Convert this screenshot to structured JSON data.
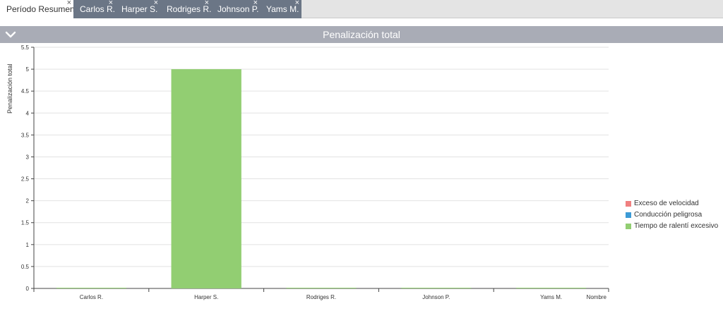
{
  "tabs": [
    {
      "label": "Período Resumen",
      "active": true
    },
    {
      "label": "Carlos R.",
      "active": false
    },
    {
      "label": "Harper S.",
      "active": false
    },
    {
      "label": "Rodriges R.",
      "active": false
    },
    {
      "label": "Johnson P.",
      "active": false
    },
    {
      "label": "Yams M.",
      "active": false
    }
  ],
  "tab_close_glyph": "×",
  "panel": {
    "title": "Penalización total",
    "collapse_icon": "chevron-down-icon"
  },
  "colors": {
    "speeding": "#f08080",
    "dangerous": "#3c9bd6",
    "idle": "#92ce72",
    "header": "#a9acb6",
    "tab": "#6b7686"
  },
  "chart_data": {
    "type": "bar",
    "ylabel": "Penalización total",
    "xlabel": "Nombre",
    "ylim": [
      0,
      5.5
    ],
    "yticks": [
      "0",
      "0.5",
      "1",
      "1.5",
      "2",
      "2.5",
      "3",
      "3.5",
      "4",
      "4.5",
      "5",
      "5.5"
    ],
    "categories": [
      "Carlos R.",
      "Harper S.",
      "Rodriges R.",
      "Johnson P.",
      "Yams M."
    ],
    "series": [
      {
        "name": "Exceso de velocidad",
        "color": "#f08080",
        "values": [
          0,
          0,
          0,
          0,
          0
        ]
      },
      {
        "name": "Conducción peligrosa",
        "color": "#3c9bd6",
        "values": [
          0,
          0,
          0,
          0,
          0
        ]
      },
      {
        "name": "Tiempo de ralentí excesivo",
        "color": "#92ce72",
        "values": [
          0,
          5,
          0,
          0,
          0
        ]
      }
    ],
    "grid": true,
    "legend": "right"
  }
}
